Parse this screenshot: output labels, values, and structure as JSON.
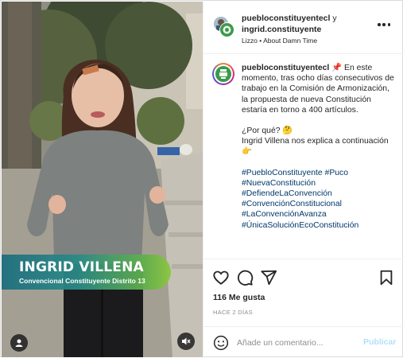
{
  "media": {
    "lower_third_name": "INGRID VILLENA",
    "lower_third_role": "Convencional Constituyente Distrito 13",
    "user_icon": "user-icon",
    "mute_icon": "speaker-muted-icon"
  },
  "header": {
    "account1": "puebloconstituyentecl",
    "connector": "y",
    "account2": "ingrid.constituyente",
    "audio": "Lizzo • About Damn Time",
    "more_icon": "more-horizontal-icon"
  },
  "caption": {
    "username": "puebloconstituyentecl",
    "pin_emoji": "📌",
    "body": "En este momento, tras ocho días consecutivos de trabajo en la Comisión de Armonización, la propuesta de nueva Constitución estaría en torno a 400 artículos.",
    "question": "¿Por qué? 🤔",
    "explain": "Ingrid Villena nos explica a continuación 👉",
    "hashtags": [
      "#PuebloConstituyente #Puco",
      "#NuevaConstitución",
      "#DefiendeLaConvención",
      "#ConvenciónConstitucional",
      "#LaConvenciónAvanza",
      "#ÚnicaSoluciónEcoConstitución"
    ]
  },
  "actions": {
    "like_icon": "heart-icon",
    "comment_icon": "comment-icon",
    "share_icon": "send-icon",
    "save_icon": "bookmark-icon",
    "likes": "116 Me gusta",
    "time": "HACE 2 DÍAS"
  },
  "comment": {
    "emoji_icon": "emoji-icon",
    "placeholder": "Añade un comentario...",
    "publish_label": "Publicar"
  },
  "colors": {
    "link": "#00376b",
    "publish_disabled": "#b2dffc",
    "lower_third_start": "#1e6e7e",
    "lower_third_end": "#8cc63f"
  }
}
